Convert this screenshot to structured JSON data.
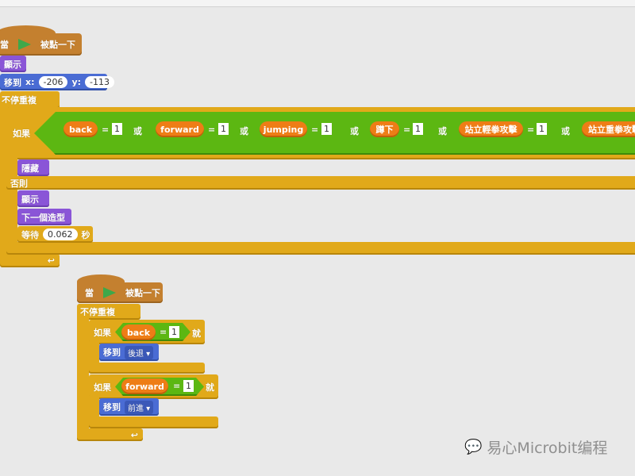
{
  "script1": {
    "hat": {
      "when": "當",
      "flag_icon": "green-flag-icon",
      "clicked": "被點一下"
    },
    "show": "顯示",
    "goto": {
      "label": "移到",
      "x_label": "x:",
      "x": "-206",
      "y_label": "y:",
      "y": "-113"
    },
    "forever": "不停重複",
    "if_label": "如果",
    "or_label": "或",
    "eq": "=",
    "conditions": [
      {
        "var": "back",
        "value": "1"
      },
      {
        "var": "forward",
        "value": "1"
      },
      {
        "var": "jumping",
        "value": "1"
      },
      {
        "var": "蹲下",
        "value": "1"
      },
      {
        "var": "站立輕拳攻擊",
        "value": "1"
      },
      {
        "var": "站立重拳攻擊"
      }
    ],
    "hide": "隱藏",
    "else_label": "否則",
    "show2": "顯示",
    "next_costume": "下一個造型",
    "wait": {
      "label": "等待",
      "value": "0.062",
      "unit": "秒"
    }
  },
  "script2": {
    "hat": {
      "when": "當",
      "flag_icon": "green-flag-icon",
      "clicked": "被點一下"
    },
    "forever": "不停重複",
    "if1": {
      "if_label": "如果",
      "var": "back",
      "eq": "=",
      "value": "1",
      "then": "就",
      "move_label": "移到",
      "move_option": "後退"
    },
    "if2": {
      "if_label": "如果",
      "var": "forward",
      "eq": "=",
      "value": "1",
      "then": "就",
      "move_label": "移到",
      "move_option": "前進"
    }
  },
  "watermark": "易心Microbit编程",
  "colors": {
    "events": "#c4802f",
    "looks": "#8a55d7",
    "motion": "#4a6cd4",
    "control": "#e1a91a",
    "operators": "#5cb712",
    "variables": "#ee7d16"
  }
}
